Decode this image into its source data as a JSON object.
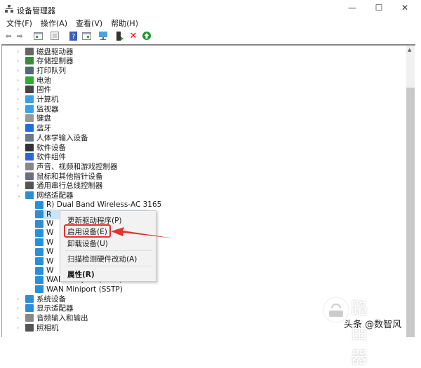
{
  "window": {
    "title": "设备管理器",
    "minimize": "—",
    "maximize": "☐",
    "close": "✕"
  },
  "menubar": [
    "文件(F)",
    "操作(A)",
    "查看(V)",
    "帮助(H)"
  ],
  "toolbar_icons": [
    "back-icon",
    "forward-icon",
    "show-hide-console-icon",
    "properties-icon",
    "help-icon",
    "action-pane-icon",
    "scan-hardware-icon",
    "update-driver-icon",
    "uninstall-icon",
    "enable-device-icon"
  ],
  "tree": [
    {
      "label": "磁盘驱动器",
      "icon": "disk-icon"
    },
    {
      "label": "存储控制器",
      "icon": "storage-icon"
    },
    {
      "label": "打印队列",
      "icon": "printer-icon"
    },
    {
      "label": "电池",
      "icon": "battery-icon"
    },
    {
      "label": "固件",
      "icon": "firmware-icon"
    },
    {
      "label": "计算机",
      "icon": "computer-icon"
    },
    {
      "label": "监视器",
      "icon": "monitor-icon"
    },
    {
      "label": "键盘",
      "icon": "keyboard-icon"
    },
    {
      "label": "蓝牙",
      "icon": "bluetooth-icon"
    },
    {
      "label": "人体学输入设备",
      "icon": "hid-icon"
    },
    {
      "label": "软件设备",
      "icon": "software-device-icon"
    },
    {
      "label": "软件组件",
      "icon": "software-component-icon"
    },
    {
      "label": "声音、视频和游戏控制器",
      "icon": "sound-icon"
    },
    {
      "label": "鼠标和其他指针设备",
      "icon": "mouse-icon"
    },
    {
      "label": "通用串行总线控制器",
      "icon": "usb-icon"
    },
    {
      "label": "网络适配器",
      "icon": "network-icon",
      "expanded": true
    }
  ],
  "network_children": [
    "R) Dual Band Wireless-AC 3165",
    "R",
    "W",
    "W",
    "W",
    "W",
    "W",
    "W",
    "WAN Miniport (PPTP)",
    "WAN Miniport (SSTP)"
  ],
  "tree_after": [
    {
      "label": "系统设备",
      "icon": "system-icon"
    },
    {
      "label": "显示适配器",
      "icon": "display-adapter-icon"
    },
    {
      "label": "音频输入和输出",
      "icon": "audio-icon"
    },
    {
      "label": "照相机",
      "icon": "camera-icon"
    }
  ],
  "context_menu": {
    "update": "更新驱动程序(P)",
    "enable": "启用设备(E)",
    "uninstall": "卸载设备(U)",
    "scan": "扫描检测硬件改动(A)",
    "properties": "属性(R)"
  },
  "watermark": {
    "brand": "路由器",
    "caption": "头条 @数智风"
  },
  "colors": {
    "highlight": "#e53030",
    "selection": "#cce4f7"
  }
}
